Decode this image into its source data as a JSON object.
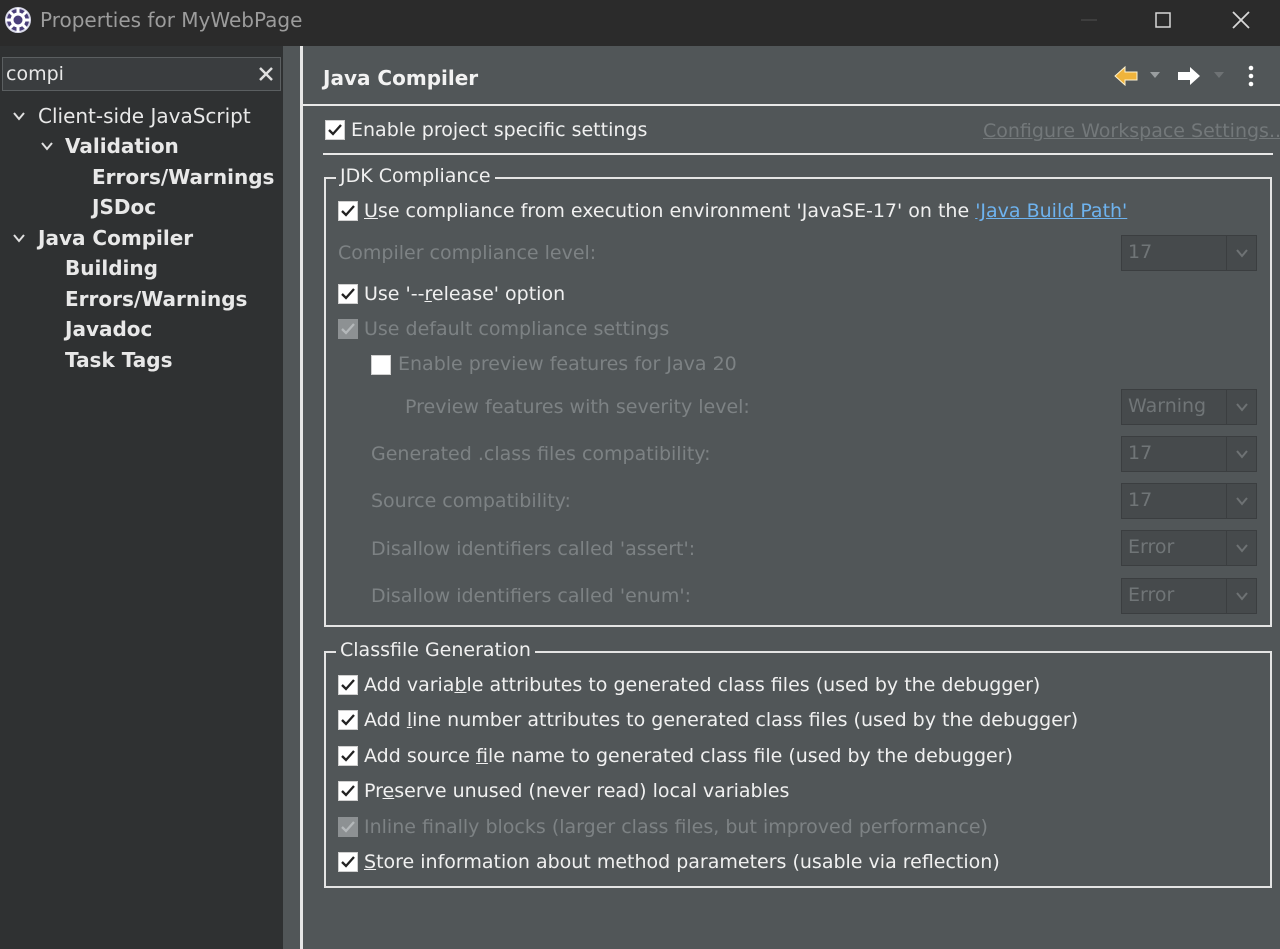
{
  "window": {
    "title": "Properties for MyWebPage"
  },
  "sidebar": {
    "search_value": "compi",
    "items": [
      {
        "label": "Client-side JavaScript"
      },
      {
        "label": "Validation"
      },
      {
        "label": "Errors/Warnings"
      },
      {
        "label": "JSDoc"
      },
      {
        "label": "Java Compiler"
      },
      {
        "label": "Building"
      },
      {
        "label": "Errors/Warnings"
      },
      {
        "label": "Javadoc"
      },
      {
        "label": "Task Tags"
      }
    ]
  },
  "main": {
    "title": "Java Compiler",
    "enable_project": {
      "label_a": "Enable pro",
      "label_u": "j",
      "label_b": "ect specific settings",
      "checked": true
    },
    "configure_link": "Configure Workspace Settings...",
    "jdk": {
      "title": "JDK Compliance",
      "use_compliance_u": "U",
      "use_compliance_text": "se compliance from execution environment 'JavaSE-17' on the ",
      "build_path_link": "'Java Build Path'",
      "compliance_level_label": "Compiler compliance level:",
      "compliance_level_value": "17",
      "release_a": "Use '--",
      "release_u": "r",
      "release_b": "elease' option",
      "default_settings": "Use default compliance settings",
      "preview": "Enable preview features for Java 20",
      "preview_severity_label": "Preview features with severity level:",
      "preview_severity_value": "Warning",
      "generated_label": "Generated .class files compatibility:",
      "generated_value": "17",
      "source_label": "Source compatibility:",
      "source_value": "17",
      "assert_label": "Disallow identifiers called 'assert':",
      "assert_value": "Error",
      "enum_label": "Disallow identifiers called 'enum':",
      "enum_value": "Error"
    },
    "classfile": {
      "title": "Classfile Generation",
      "var_a": "Add varia",
      "var_u": "b",
      "var_b": "le attributes to generated class files (used by the debugger)",
      "line_a": "Add ",
      "line_u": "l",
      "line_b": "ine number attributes to generated class files (used by the debugger)",
      "src_a": "Add source ",
      "src_u": "f",
      "src_b": "ile name to generated class file (used by the debugger)",
      "pres_a": "Pr",
      "pres_u": "e",
      "pres_b": "serve unused (never read) local variables",
      "inline": "Inline finally blocks (larger class files, but improved performance)",
      "store_u": "S",
      "store_b": "tore information about method parameters (usable via reflection)"
    }
  },
  "colors": {
    "background": "#515658",
    "sidebar": "#2f3132",
    "titlebar": "#2b2b2b",
    "link": "#6eb3ef",
    "back_arrow": "#f0b43c"
  },
  "icons": [
    "app-icon",
    "minimize-icon",
    "maximize-icon",
    "close-icon",
    "clear-search-icon",
    "chevron-down-icon",
    "back-arrow-icon",
    "forward-arrow-icon",
    "menu-icon",
    "checkmark-icon"
  ]
}
